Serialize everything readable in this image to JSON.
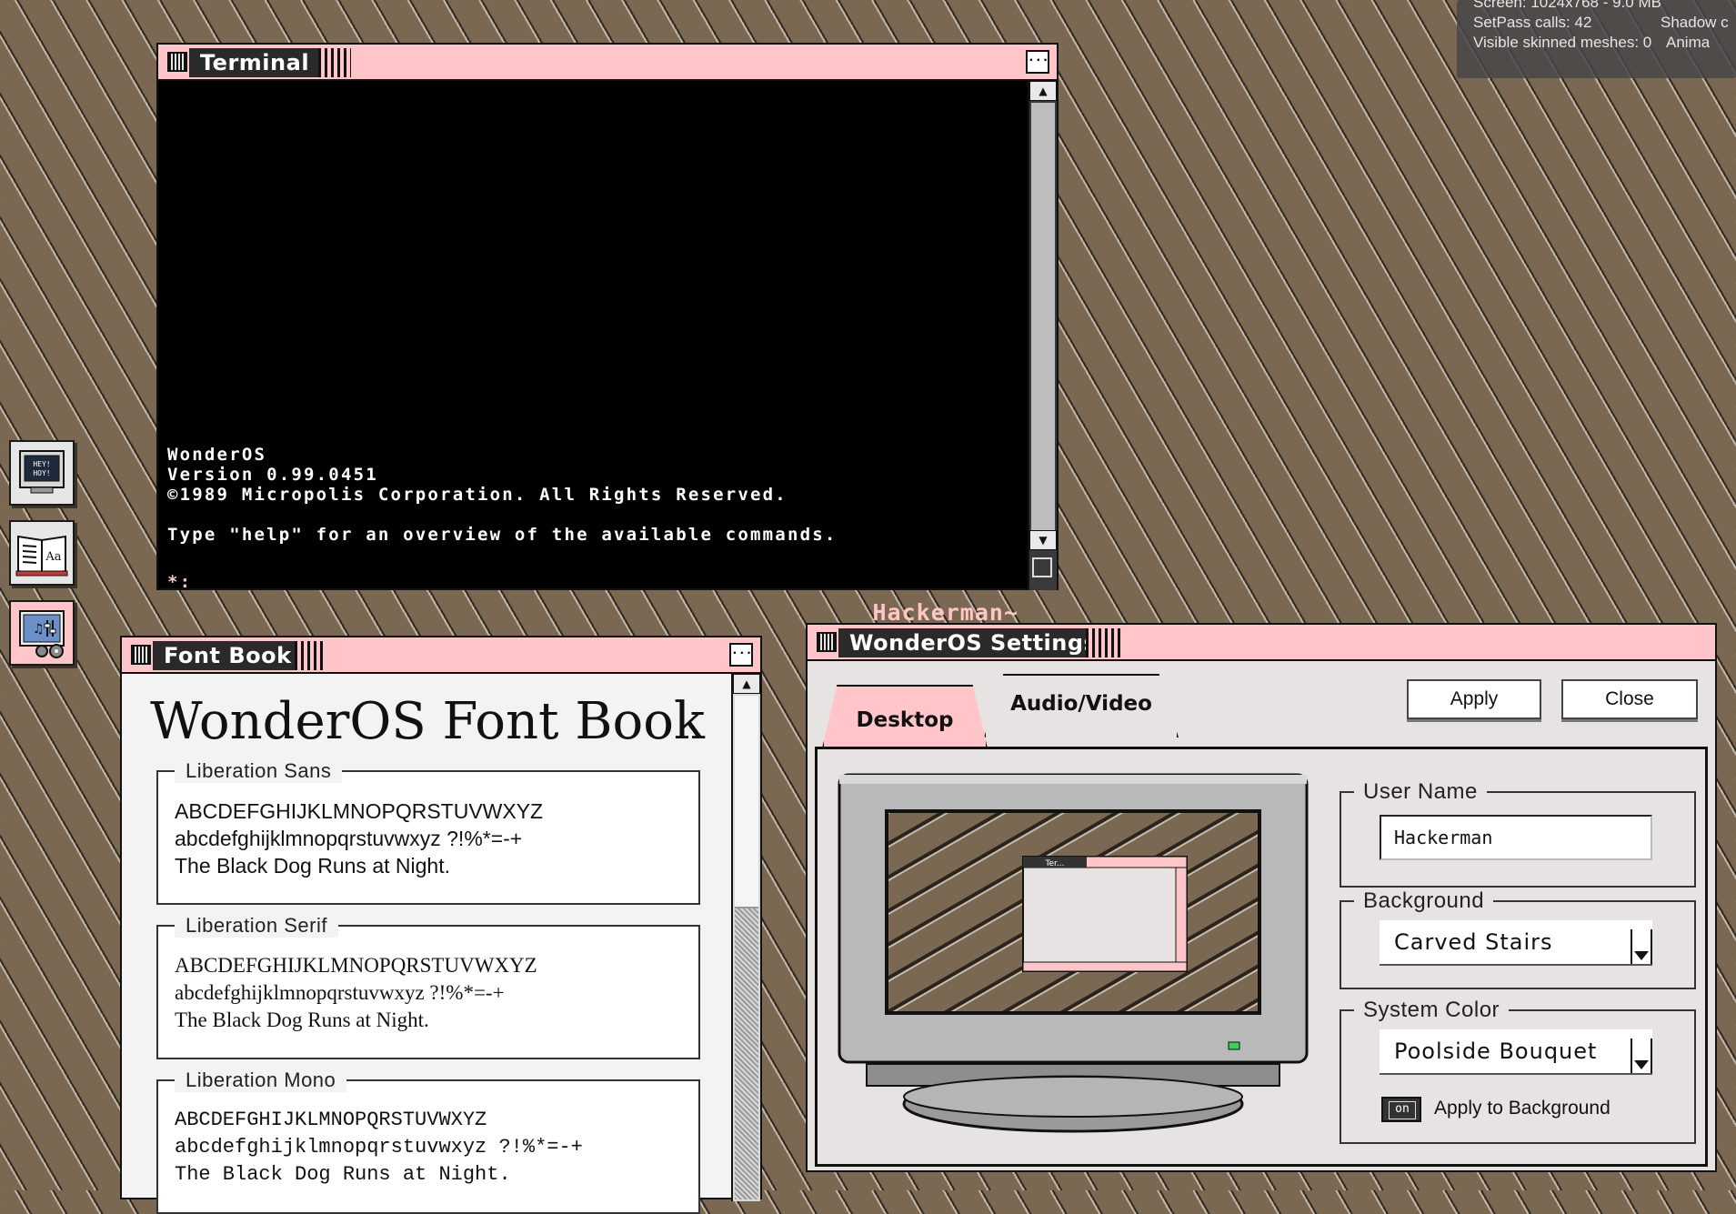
{
  "stats": {
    "line1": "Screen: 1024x768 - 9.0 MB",
    "line2": "SetPass calls: 42",
    "line2b": "Shadow c",
    "line3": "Visible skinned meshes: 0",
    "line3b": "Anima"
  },
  "terminal": {
    "title": "Terminal",
    "menu_glyph": "...",
    "lines": [
      "WonderOS",
      "Version 0.99.0451",
      "©1989 Micropolis Corporation. All Rights Reserved.",
      "",
      "Type \"help\" for an overview of the available commands.",
      "",
      "*:"
    ],
    "status": "Hackerman~"
  },
  "desktop_icons": [
    {
      "name": "terminal-app-icon",
      "label": "HEY! HOY!"
    },
    {
      "name": "fontbook-app-icon",
      "label": "Aa"
    },
    {
      "name": "settings-app-icon",
      "label": "settings"
    }
  ],
  "fontbook": {
    "title": "Font Book",
    "menu_glyph": "...",
    "heading": "WonderOS Font Book",
    "fonts": [
      {
        "name": "Liberation Sans",
        "upper": "ABCDEFGHIJKLMNOPQRSTUVWXYZ",
        "lower": "abcdefghijklmnopqrstuvwxyz ?!%*=-+",
        "sentence": "The Black Dog Runs at Night."
      },
      {
        "name": "Liberation Serif",
        "upper": "ABCDEFGHIJKLMNOPQRSTUVWXYZ",
        "lower": "abcdefghijklmnopqrstuvwxyz ?!%*=-+",
        "sentence": "The Black Dog Runs at Night."
      },
      {
        "name": "Liberation Mono",
        "upper": "ABCDEFGHIJKLMNOPQRSTUVWXYZ",
        "lower": "abcdefghijklmnopqrstuvwxyz ?!%*=-+",
        "sentence": "The Black Dog Runs at Night."
      }
    ]
  },
  "settings": {
    "title": "WonderOS Settings",
    "tabs": [
      {
        "label": "Desktop",
        "active": true
      },
      {
        "label": "Audio/Video",
        "active": false
      }
    ],
    "apply_label": "Apply",
    "close_label": "Close",
    "preview_window_title": "Ter..."
  },
  "user_name": {
    "legend": "User Name",
    "value": "Hackerman"
  },
  "background": {
    "legend": "Background",
    "selected": "Carved Stairs"
  },
  "system_color": {
    "legend": "System Color",
    "selected": "Poolside Bouquet"
  },
  "apply_to_bg": {
    "toggle_text": "on",
    "label": "Apply to Background"
  },
  "colors": {
    "accent": "#ffc5c8",
    "desktop": "#7b6852",
    "window": "#e7e3e3",
    "terminal_status": "#ffc5c8"
  }
}
